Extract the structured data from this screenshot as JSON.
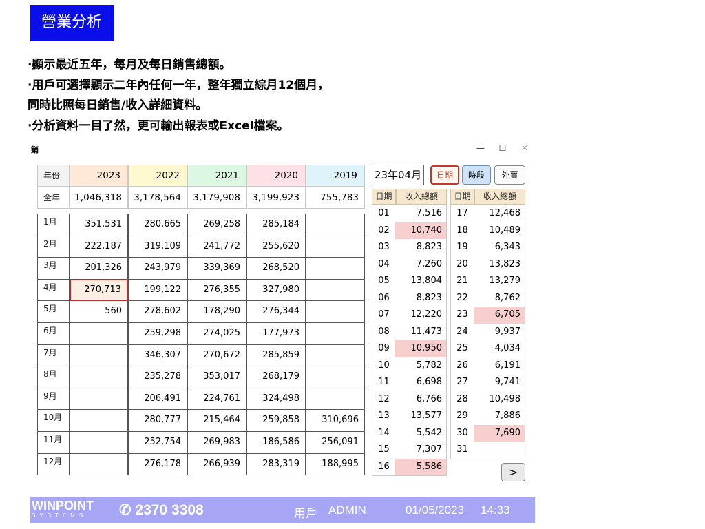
{
  "slide": {
    "title": "營業分析",
    "bullets": [
      "·顯示最近五年，每月及每日銷售總額。",
      "·用戶可選擇顯示二年內任何一年，整年獨立綜月12個月，",
      " 同時比照每日銷售/收入詳細資料。",
      "·分析資料一目了然，更可輸出報表或Excel檔案。"
    ]
  },
  "window": {
    "icon_text": "銷",
    "minimize": "—",
    "maximize": "☐",
    "close": "✕"
  },
  "yearly": {
    "year_label": "年份",
    "total_label": "全年",
    "years": [
      "2023",
      "2022",
      "2021",
      "2020",
      "2019"
    ],
    "year_colors": [
      "#fde9d6",
      "#fdf8cf",
      "#dcf8e2",
      "#fde1e6",
      "#dff3fb"
    ],
    "totals": [
      "1,046,318",
      "3,178,564",
      "3,179,908",
      "3,199,923",
      "755,783"
    ],
    "months": [
      "1月",
      "2月",
      "3月",
      "4月",
      "5月",
      "6月",
      "7月",
      "8月",
      "9月",
      "10月",
      "11月",
      "12月"
    ],
    "rows": [
      [
        "351,531",
        "280,665",
        "269,258",
        "285,184",
        ""
      ],
      [
        "222,187",
        "319,109",
        "241,772",
        "255,620",
        ""
      ],
      [
        "201,326",
        "243,979",
        "339,369",
        "268,520",
        ""
      ],
      [
        "270,713",
        "199,122",
        "276,355",
        "327,980",
        ""
      ],
      [
        "560",
        "278,602",
        "178,290",
        "276,344",
        ""
      ],
      [
        "",
        "259,298",
        "274,025",
        "177,973",
        ""
      ],
      [
        "",
        "346,307",
        "270,672",
        "285,859",
        ""
      ],
      [
        "",
        "235,278",
        "353,017",
        "268,179",
        ""
      ],
      [
        "",
        "206,491",
        "224,761",
        "324,498",
        ""
      ],
      [
        "",
        "280,777",
        "215,464",
        "259,858",
        "310,696"
      ],
      [
        "",
        "252,754",
        "269,983",
        "186,586",
        "256,091"
      ],
      [
        "",
        "276,178",
        "266,939",
        "283,319",
        "188,995"
      ]
    ],
    "selected": {
      "row": 3,
      "col": 0
    }
  },
  "daily": {
    "month_label": "23年04月",
    "tabs": [
      "日期",
      "時段",
      "外賣"
    ],
    "header_date": "日期",
    "header_total": "收入總額",
    "highlight_color": "#f7cfcf",
    "left": [
      {
        "d": "01",
        "v": "7,516",
        "h": false
      },
      {
        "d": "02",
        "v": "10,740",
        "h": true
      },
      {
        "d": "03",
        "v": "8,823",
        "h": false
      },
      {
        "d": "04",
        "v": "7,260",
        "h": false
      },
      {
        "d": "05",
        "v": "13,804",
        "h": false
      },
      {
        "d": "06",
        "v": "8,823",
        "h": false
      },
      {
        "d": "07",
        "v": "12,220",
        "h": false
      },
      {
        "d": "08",
        "v": "11,473",
        "h": false
      },
      {
        "d": "09",
        "v": "10,950",
        "h": true
      },
      {
        "d": "10",
        "v": "5,782",
        "h": false
      },
      {
        "d": "11",
        "v": "6,698",
        "h": false
      },
      {
        "d": "12",
        "v": "6,766",
        "h": false
      },
      {
        "d": "13",
        "v": "13,577",
        "h": false
      },
      {
        "d": "14",
        "v": "5,542",
        "h": false
      },
      {
        "d": "15",
        "v": "7,307",
        "h": false
      },
      {
        "d": "16",
        "v": "5,586",
        "h": true
      }
    ],
    "right": [
      {
        "d": "17",
        "v": "12,468",
        "h": false
      },
      {
        "d": "18",
        "v": "10,489",
        "h": false
      },
      {
        "d": "19",
        "v": "6,343",
        "h": false
      },
      {
        "d": "20",
        "v": "13,823",
        "h": false
      },
      {
        "d": "21",
        "v": "13,279",
        "h": false
      },
      {
        "d": "22",
        "v": "8,762",
        "h": false
      },
      {
        "d": "23",
        "v": "6,705",
        "h": true
      },
      {
        "d": "24",
        "v": "9,937",
        "h": false
      },
      {
        "d": "25",
        "v": "4,034",
        "h": false
      },
      {
        "d": "26",
        "v": "6,191",
        "h": false
      },
      {
        "d": "27",
        "v": "9,741",
        "h": false
      },
      {
        "d": "28",
        "v": "10,498",
        "h": false
      },
      {
        "d": "29",
        "v": "7,886",
        "h": false
      },
      {
        "d": "30",
        "v": "7,690",
        "h": true
      },
      {
        "d": "31",
        "v": "",
        "h": false
      }
    ],
    "next_label": ">"
  },
  "footer": {
    "logo": "WINPOINT",
    "logo_sub": "SYSTEMS",
    "phone": "✆ 2370 3308",
    "user_label": "用戶",
    "user": "ADMIN",
    "date": "01/05/2023",
    "time": "14:33"
  }
}
